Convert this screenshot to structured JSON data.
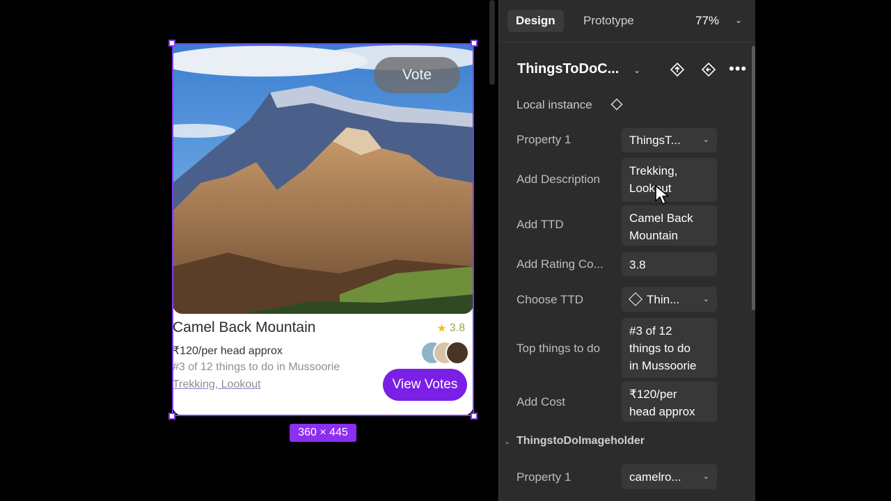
{
  "canvas": {
    "card": {
      "vote_label": "Vote",
      "title": "Camel Back Mountain",
      "rating": "3.8",
      "price": "₹120/per head approx",
      "rank": "#3 of 12 things to do in Mussoorie",
      "tags": "Trekking, Lookout",
      "view_votes_label": "View Votes",
      "accent_color": "#7a1fe6"
    },
    "size_badge": "360 × 445"
  },
  "panel": {
    "tabs": {
      "design": "Design",
      "prototype": "Prototype"
    },
    "zoom": "77%",
    "component_name": "ThingsToDoC...",
    "local_instance": "Local instance",
    "properties": [
      {
        "label": "Property 1",
        "value": "ThingsT..."
      },
      {
        "label": "Add Description",
        "value_line1": "Trekking,",
        "value_line2": "Lookout"
      },
      {
        "label": "Add TTD",
        "value_line1": "Camel Back",
        "value_line2": "Mountain"
      },
      {
        "label": "Add Rating Co...",
        "value": "3.8"
      },
      {
        "label": "Choose TTD",
        "value": "Thin..."
      },
      {
        "label": "Top things to do",
        "value_line1": "#3 of 12",
        "value_line2": "things to do",
        "value_line3": "in Mussoorie"
      },
      {
        "label": "Add Cost",
        "value_line1": "₹120/per",
        "value_line2": "head approx"
      }
    ],
    "section": {
      "title": "ThingstoDoImageholder",
      "property_label": "Property 1",
      "property_value": "camelro..."
    }
  }
}
